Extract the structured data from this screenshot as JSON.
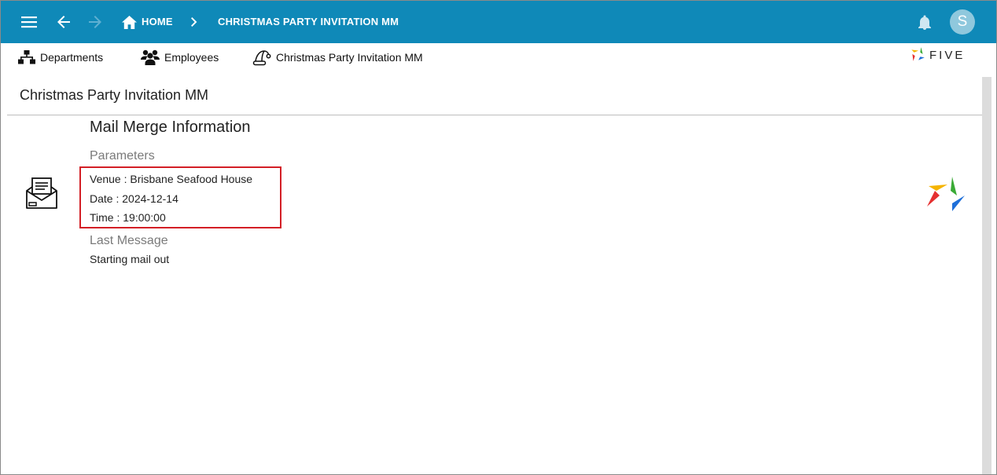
{
  "appbar": {
    "home_label": "HOME",
    "page_label": "CHRISTMAS PARTY INVITATION MM",
    "avatar_initial": "S",
    "color": "#0f89b8"
  },
  "toolbar": {
    "items": [
      {
        "label": "Departments",
        "icon": "org-chart-icon"
      },
      {
        "label": "Employees",
        "icon": "people-icon"
      },
      {
        "label": "Christmas Party Invitation MM",
        "icon": "santa-hat-icon"
      }
    ],
    "logo_text": "FIVE"
  },
  "page": {
    "title": "Christmas Party Invitation MM"
  },
  "mail_merge": {
    "heading": "Mail Merge Information",
    "parameters_label": "Parameters",
    "parameters": [
      "Venue : Brisbane Seafood House",
      "Date : 2024-12-14",
      "Time : 19:00:00"
    ],
    "last_message_label": "Last Message",
    "last_message": "Starting mail out",
    "highlight_color": "#d31f26"
  }
}
